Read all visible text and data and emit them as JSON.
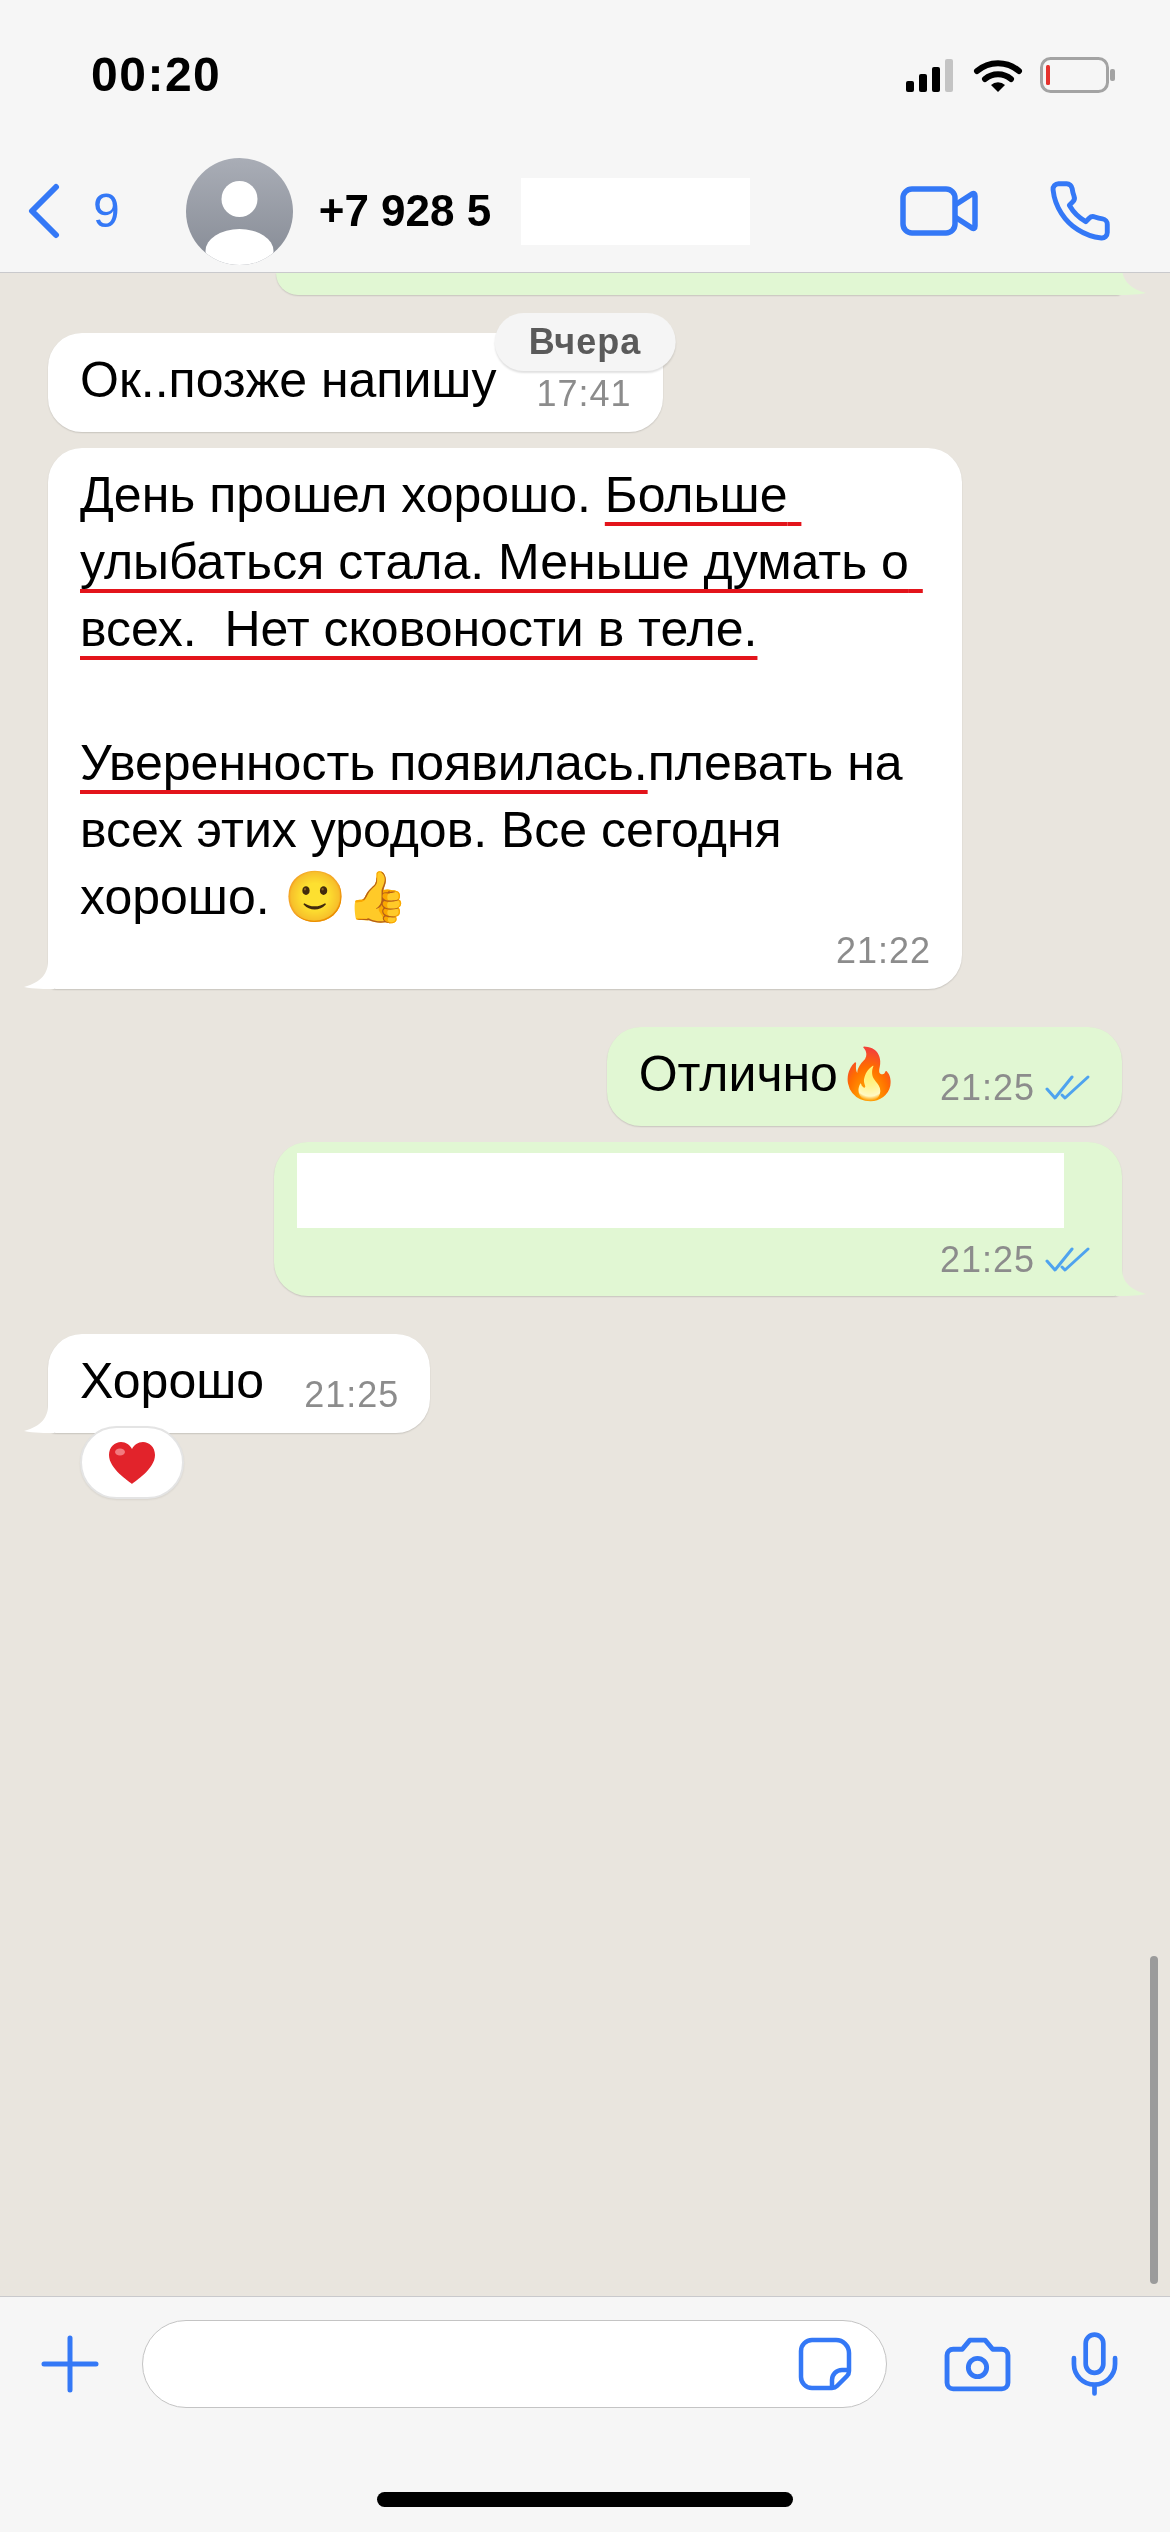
{
  "status_bar": {
    "time": "00:20"
  },
  "header": {
    "back_count": "9",
    "contact": "+7 928 5",
    "contact_redacted": true
  },
  "chat": {
    "date_label": "Вчера",
    "messages": [
      {
        "kind": "cut_off",
        "outgoing": true,
        "tail": true
      },
      {
        "kind": "text",
        "outgoing": false,
        "tail": false,
        "segments": [
          {
            "text": "Ок..позже напишу",
            "underlined": false
          }
        ],
        "time": "17:41"
      },
      {
        "kind": "text",
        "outgoing": false,
        "tail": true,
        "segments": [
          {
            "text": "День прошел хорошо. ",
            "underlined": false
          },
          {
            "text": "Больше улыбаться стала. Меньше думать о всех.  Нет сковоности в теле.\n\n",
            "underlined": true
          },
          {
            "text": "Уверенность появилась.",
            "underlined": true
          },
          {
            "text": "плевать на всех этих уродов. Все сегодня хорошо. 🙂👍",
            "underlined": false
          }
        ],
        "time": "21:22"
      },
      {
        "kind": "text",
        "outgoing": true,
        "tail": false,
        "segments": [
          {
            "text": "Отлично🔥",
            "underlined": false
          }
        ],
        "time": "21:25",
        "read": true
      },
      {
        "kind": "redacted",
        "outgoing": true,
        "tail": true,
        "time": "21:25",
        "read": true
      },
      {
        "kind": "text",
        "outgoing": false,
        "tail": true,
        "segments": [
          {
            "text": "Хорошо",
            "underlined": false
          }
        ],
        "time": "21:25",
        "reaction": {
          "kind": "heart"
        }
      }
    ]
  }
}
